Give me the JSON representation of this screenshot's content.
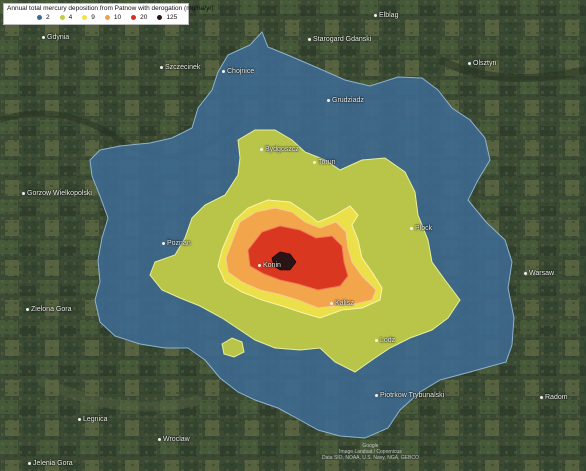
{
  "legend": {
    "title": "Annual total mercury deposition from Patnow with derogation (mg/ha/yr)",
    "items": [
      {
        "label": "2",
        "color": "#3d6a92"
      },
      {
        "label": "4",
        "color": "#c3cd43"
      },
      {
        "label": "9",
        "color": "#f2e24a"
      },
      {
        "label": "10",
        "color": "#f2a14a"
      },
      {
        "label": "20",
        "color": "#d8301f"
      },
      {
        "label": "125",
        "color": "#2a1416"
      }
    ]
  },
  "cities": {
    "elblag": "Elblag",
    "gdynia": "Gdynia",
    "starogard": "Starogard Gdanski",
    "olsztyn": "Olsztyn",
    "szczecinek": "Szczecinek",
    "chojnice": "Chojnice",
    "grudziadz": "Grudziadz",
    "bydgoszcz": "Bydgoszcz",
    "torun": "Torun",
    "gorzow": "Gorzow Wielkopolski",
    "plock": "Plock",
    "poznan": "Poznan",
    "konin": "Konin",
    "warsaw": "Warsaw",
    "kalisz": "Kalisz",
    "lodz": "Lodz",
    "zielona_gora": "Zielona Gora",
    "piotrkow": "Piotrkow Trybunalski",
    "radom": "Radom",
    "legnica": "Legnica",
    "wroclaw": "Wroclaw",
    "jelenia_gora": "Jelenia Gora"
  },
  "attribution": [
    "Google",
    "Image Landsat / Copernicus",
    "Data SIO, NOAA, U.S. Navy, NGA, GEBCO"
  ]
}
